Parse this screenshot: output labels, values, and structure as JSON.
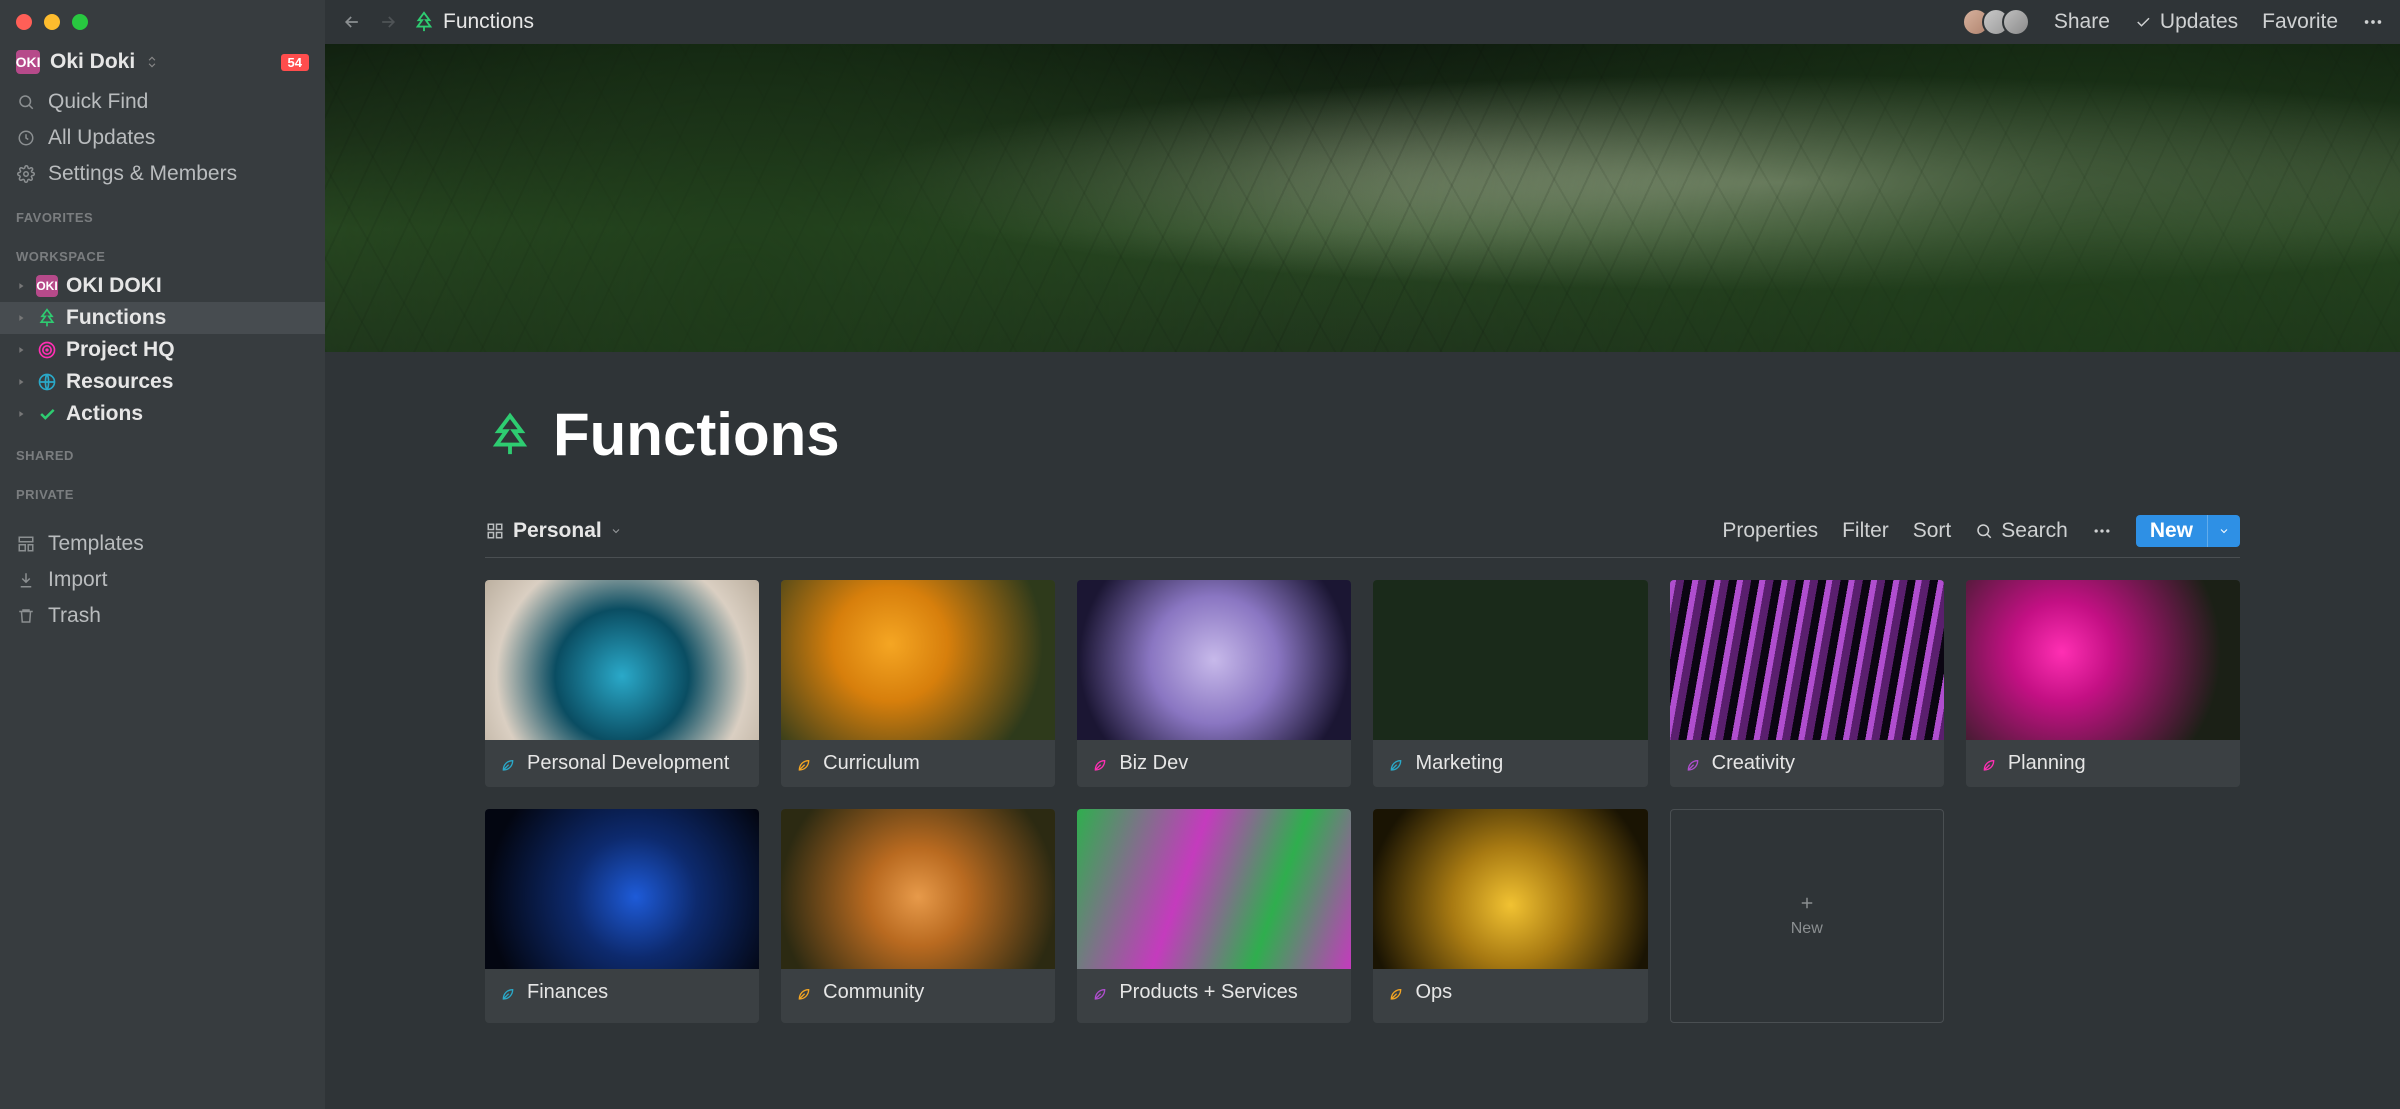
{
  "workspace": {
    "name": "Oki Doki",
    "badge_text": "OKI",
    "notification_count": "54"
  },
  "sidebar_top": [
    {
      "icon": "search-icon",
      "label": "Quick Find"
    },
    {
      "icon": "clock-icon",
      "label": "All Updates"
    },
    {
      "icon": "gear-icon",
      "label": "Settings & Members"
    }
  ],
  "sidebar_sections": {
    "favorites": "FAVORITES",
    "workspace": "WORKSPACE",
    "shared": "SHARED",
    "private": "PRIVATE"
  },
  "workspace_tree": [
    {
      "icon": "box",
      "label": "OKI DOKI",
      "badge": "OKI",
      "active": false
    },
    {
      "icon": "tree",
      "label": "Functions",
      "color": "#2ecc71",
      "active": true
    },
    {
      "icon": "target",
      "label": "Project HQ",
      "color": "#ff2fb3",
      "active": false
    },
    {
      "icon": "globe",
      "label": "Resources",
      "color": "#2aa9c9",
      "active": false
    },
    {
      "icon": "check",
      "label": "Actions",
      "color": "#2ecc71",
      "active": false
    }
  ],
  "sidebar_bottom": [
    {
      "icon": "template-icon",
      "label": "Templates"
    },
    {
      "icon": "download-icon",
      "label": "Import"
    },
    {
      "icon": "trash-icon",
      "label": "Trash"
    }
  ],
  "breadcrumb": {
    "title": "Functions"
  },
  "topbar": {
    "share": "Share",
    "updates": "Updates",
    "favorite": "Favorite"
  },
  "page": {
    "title": "Functions"
  },
  "view": {
    "name": "Personal"
  },
  "view_controls": {
    "properties": "Properties",
    "filter": "Filter",
    "sort": "Sort",
    "search": "Search",
    "new": "New"
  },
  "gallery": [
    {
      "title": "Personal Development",
      "cov": "cov-personal",
      "icon_color": "#2aa9c9"
    },
    {
      "title": "Curriculum",
      "cov": "cov-curriculum",
      "icon_color": "#f5a623"
    },
    {
      "title": "Biz Dev",
      "cov": "cov-bizdev",
      "icon_color": "#ff2fb3"
    },
    {
      "title": "Marketing",
      "cov": "cov-marketing",
      "icon_color": "#2aa9c9"
    },
    {
      "title": "Creativity",
      "cov": "cov-creativity",
      "icon_color": "#b04ecf"
    },
    {
      "title": "Planning",
      "cov": "cov-planning",
      "icon_color": "#ff2fb3"
    },
    {
      "title": "Finances",
      "cov": "cov-finances",
      "icon_color": "#2aa9c9"
    },
    {
      "title": "Community",
      "cov": "cov-community",
      "icon_color": "#f5a623"
    },
    {
      "title": "Products + Services",
      "cov": "cov-products",
      "icon_color": "#b04ecf"
    },
    {
      "title": "Ops",
      "cov": "cov-ops",
      "icon_color": "#f5a623"
    }
  ],
  "gallery_new": "New"
}
